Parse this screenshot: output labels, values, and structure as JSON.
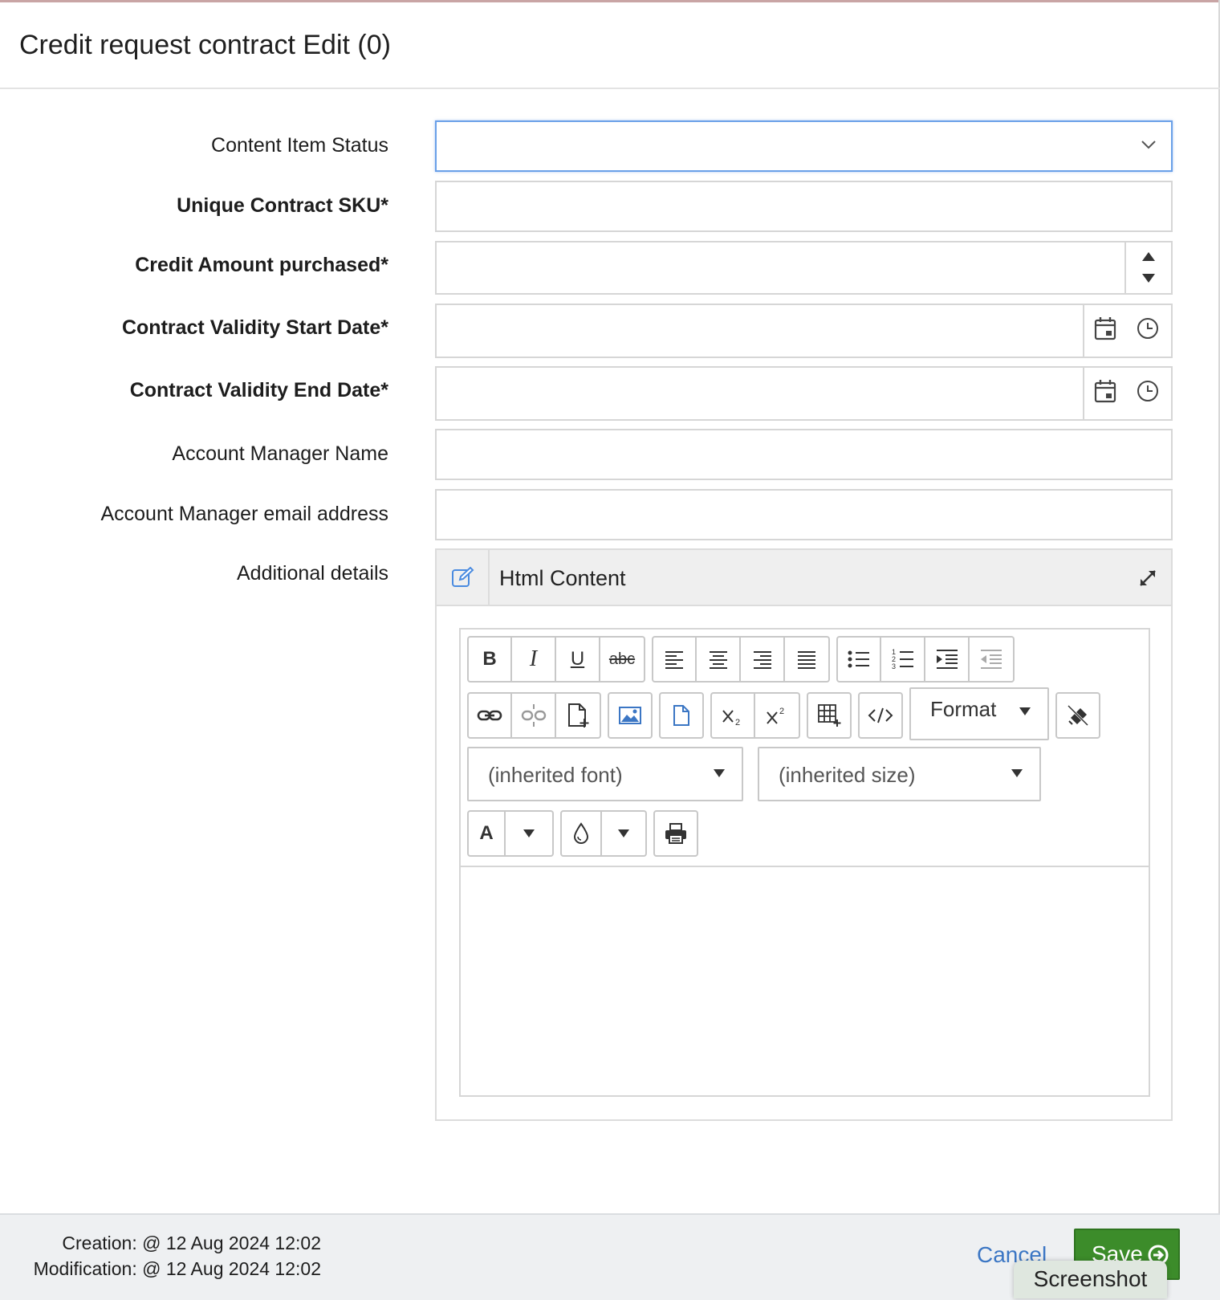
{
  "dialog": {
    "title": "Credit request contract Edit (0)"
  },
  "form": {
    "content_item_status": {
      "label": "Content Item Status",
      "value": ""
    },
    "unique_contract_sku": {
      "label": "Unique Contract SKU*",
      "value": ""
    },
    "credit_amount_purchased": {
      "label": "Credit Amount purchased*",
      "value": ""
    },
    "contract_validity_start": {
      "label": "Contract Validity Start Date*",
      "value": ""
    },
    "contract_validity_end": {
      "label": "Contract Validity End Date*",
      "value": ""
    },
    "account_manager_name": {
      "label": "Account Manager Name",
      "value": ""
    },
    "account_manager_email": {
      "label": "Account Manager email address",
      "value": ""
    },
    "additional_details": {
      "label": "Additional details"
    }
  },
  "editor": {
    "panel_title": "Html Content",
    "bold": "B",
    "italic": "I",
    "underline": "U",
    "strikethrough": "abc",
    "format_label": "Format",
    "font_select": "(inherited font)",
    "size_select": "(inherited size)",
    "font_color": "A"
  },
  "footer": {
    "creation": "Creation: @ 12 Aug 2024 12:02",
    "modification": "Modification: @ 12 Aug 2024 12:02",
    "cancel": "Cancel",
    "save": "Save"
  },
  "overlay": {
    "tooltip": "Screenshot"
  },
  "colors": {
    "accent": "#3b76c4",
    "save": "#3c8c2a",
    "focus": "#6aa0e8"
  }
}
